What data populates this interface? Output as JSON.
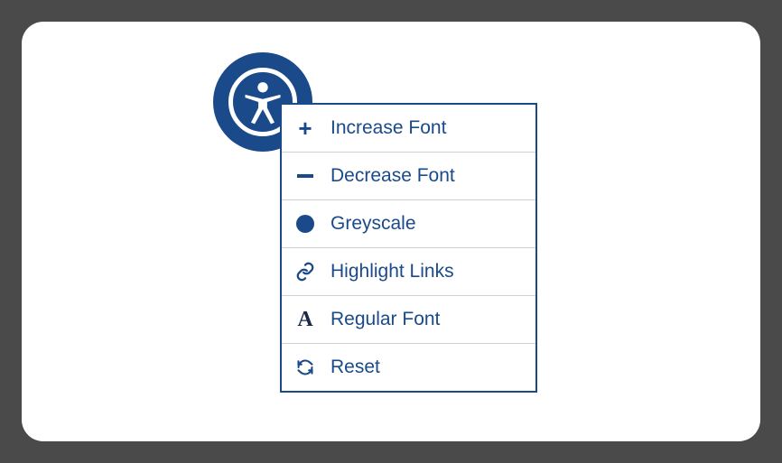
{
  "colors": {
    "primary": "#1a4a8a",
    "white": "#ffffff",
    "frame": "#4a4a4a",
    "divider": "#d0d0d0"
  },
  "a11y_button": {
    "icon": "accessibility-person"
  },
  "menu": {
    "items": [
      {
        "icon": "plus",
        "label": "Increase Font"
      },
      {
        "icon": "minus",
        "label": "Decrease Font"
      },
      {
        "icon": "dot",
        "label": "Greyscale"
      },
      {
        "icon": "link",
        "label": "Highlight Links"
      },
      {
        "icon": "font-a",
        "label": "Regular Font"
      },
      {
        "icon": "refresh",
        "label": "Reset"
      }
    ]
  }
}
